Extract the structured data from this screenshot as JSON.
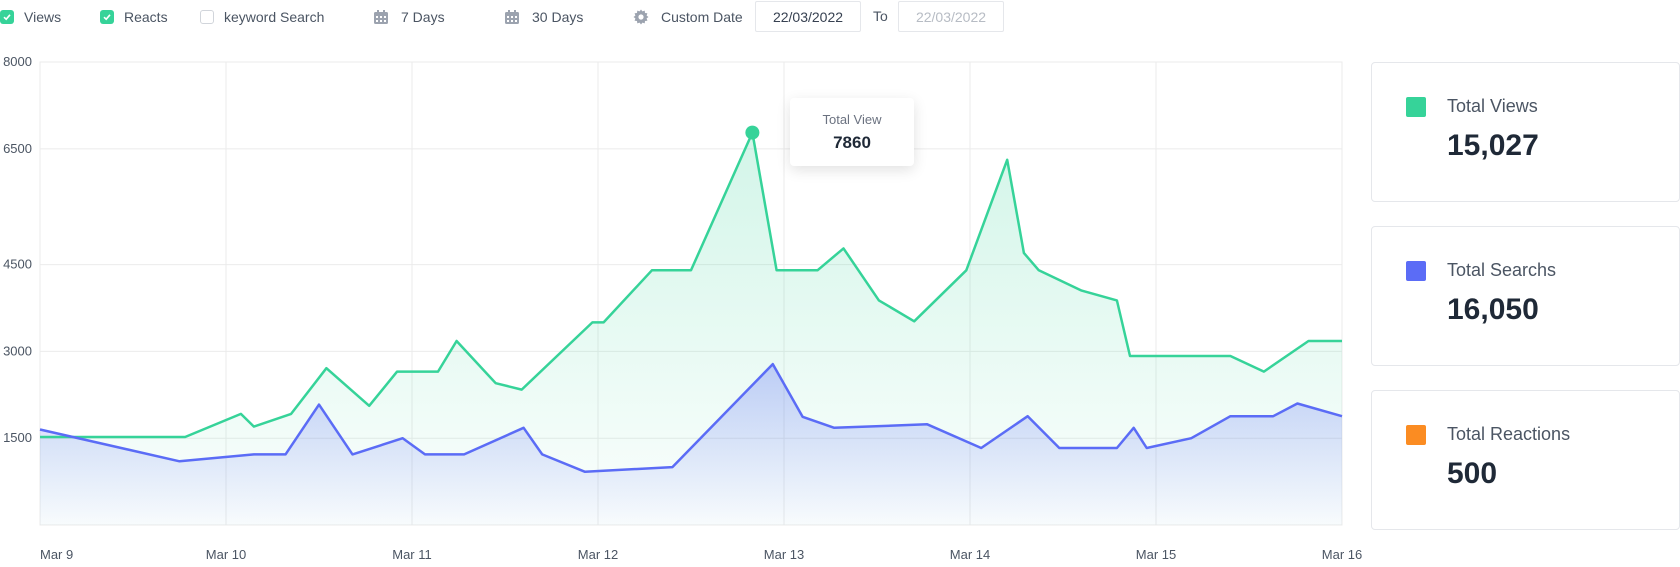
{
  "filters": {
    "views": {
      "label": "Views",
      "checked": true
    },
    "reacts": {
      "label": "Reacts",
      "checked": true
    },
    "keyword": {
      "label": "keyword Search",
      "checked": false
    }
  },
  "ranges": {
    "seven_days": "7 Days",
    "thirty_days": "30 Days",
    "custom": "Custom Date"
  },
  "date_from": "22/03/2022",
  "date_to_label": "To",
  "date_to": "22/03/2022",
  "tooltip": {
    "label": "Total View",
    "value": "7860"
  },
  "stats": [
    {
      "label": "Total Views",
      "value": "15,027",
      "color": "#36d399"
    },
    {
      "label": "Total Searchs",
      "value": "16,050",
      "color": "#5b6cf6"
    },
    {
      "label": "Total Reactions",
      "value": "500",
      "color": "#fb8c22"
    }
  ],
  "colors": {
    "views": "#36d399",
    "searches": "#5b6cf6",
    "grid": "#ebebeb"
  },
  "chart_data": {
    "type": "area",
    "x_labels": [
      "Mar 9",
      "Mar 10",
      "Mar 11",
      "Mar 12",
      "Mar 13",
      "Mar 14",
      "Mar 15",
      "Mar 16"
    ],
    "y_ticks": [
      1500,
      3000,
      4500,
      6500,
      8000
    ],
    "ylim": [
      0,
      8000
    ],
    "grid": true,
    "series": [
      {
        "key": "views",
        "x": [
          0,
          0.48,
          0.78,
          1.08,
          1.15,
          1.35,
          1.54,
          1.77,
          1.92,
          2.14,
          2.24,
          2.45,
          2.59,
          2.97,
          3.03,
          3.29,
          3.5,
          3.83,
          3.96,
          4.18,
          4.32,
          4.51,
          4.7,
          4.98,
          5.2,
          5.29,
          5.37,
          5.6,
          5.79,
          5.86,
          6.0,
          6.4,
          6.58,
          6.82,
          7.0
        ],
        "y": [
          1520,
          1520,
          1520,
          1920,
          1700,
          1920,
          2710,
          2060,
          2650,
          2650,
          3180,
          2450,
          2340,
          3500,
          3500,
          4400,
          4400,
          6780,
          4400,
          4400,
          4780,
          3880,
          3520,
          4400,
          6310,
          4700,
          4400,
          4050,
          3880,
          2920,
          2920,
          2920,
          2650,
          3180,
          3180
        ]
      },
      {
        "key": "searches",
        "x": [
          0,
          0.75,
          1.15,
          1.32,
          1.5,
          1.68,
          1.95,
          2.07,
          2.28,
          2.6,
          2.7,
          2.93,
          3.4,
          3.94,
          4.1,
          4.27,
          4.77,
          5.06,
          5.31,
          5.48,
          5.79,
          5.88,
          5.95,
          6.19,
          6.4,
          6.63,
          6.76,
          7.0
        ],
        "y": [
          1650,
          1100,
          1220,
          1220,
          2080,
          1220,
          1500,
          1220,
          1220,
          1680,
          1220,
          920,
          1000,
          2780,
          1870,
          1680,
          1740,
          1330,
          1880,
          1330,
          1330,
          1680,
          1330,
          1500,
          1880,
          1880,
          2100,
          1880
        ]
      }
    ]
  }
}
